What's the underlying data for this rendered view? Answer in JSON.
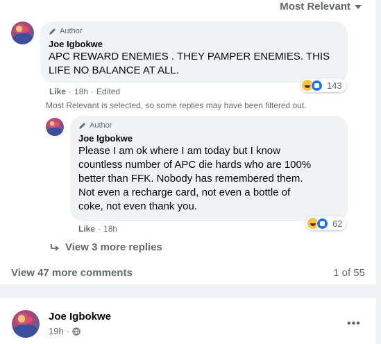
{
  "sort": {
    "label": "Most Relevant"
  },
  "comment": {
    "badge": "Author",
    "name": "Joe Igbokwe",
    "text_line1": "APC REWARD ENEMIES . THEY PAMPER ENEMIES. THIS",
    "text_line2": "LIFE NO BALANCE AT ALL.",
    "like": "Like",
    "time": "18h",
    "edited": "Edited",
    "reactions": "143"
  },
  "notice": "Most Relevant is selected, so some replies may have been filtered out.",
  "reply": {
    "badge": "Author",
    "name": "Joe Igbokwe",
    "lines": [
      "Please I am ok where I am today but I know",
      "countless number of APC die hards who are 100%",
      "better than FFK. Nobody has remembered them.",
      "Not even a recharge card, not even a bottle of",
      "coke, not even thank you."
    ],
    "like": "Like",
    "time": "18h",
    "reactions": "62"
  },
  "more_replies": "View 3 more replies",
  "view_comments": "View 47 more comments",
  "pager": "1 of 55",
  "post": {
    "name": "Joe Igbokwe",
    "time": "19h",
    "audience_icon": "globe-icon",
    "menu_icon": "more-options-icon"
  },
  "colors": {
    "bubble": "#f0f2f5",
    "secondary_text": "#65676b",
    "like_blue": "#1877f2",
    "haha_yellow": "#f7c33e"
  }
}
